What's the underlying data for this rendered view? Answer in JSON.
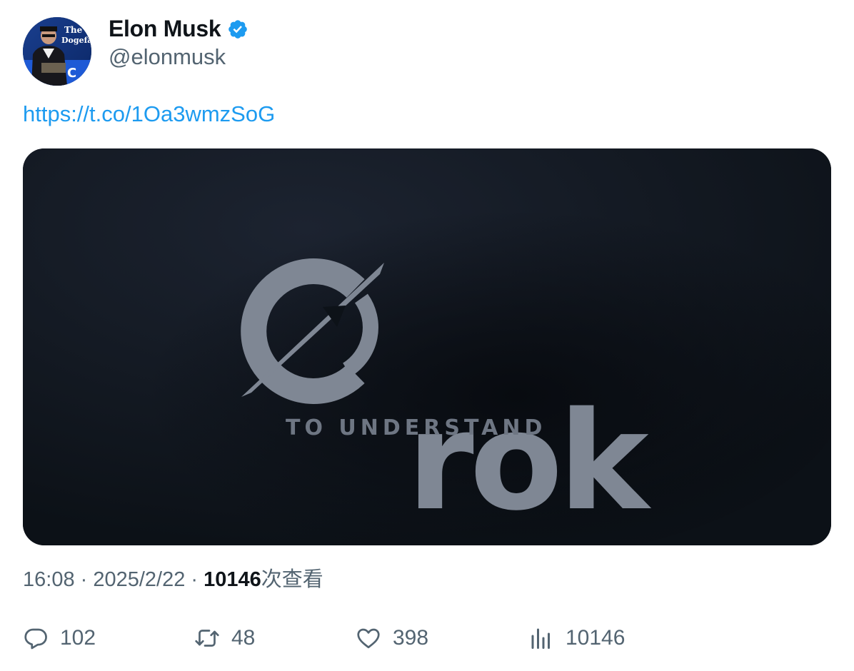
{
  "author": {
    "display_name": "Elon Musk",
    "handle": "@elonmusk",
    "verified": true,
    "avatar_text": "The Dogefa"
  },
  "tweet": {
    "link_text": "https://t.co/1Oa3wmzSoG"
  },
  "media": {
    "logo_text": "rok",
    "tagline": "TO UNDERSTAND"
  },
  "meta": {
    "time_date": "16:08 · 2025/2/22 · ",
    "views_count": "10146",
    "views_label": "次查看"
  },
  "actions": {
    "replies": "102",
    "retweets": "48",
    "likes": "398",
    "views": "10146"
  },
  "colors": {
    "link": "#1d9bf0",
    "secondary_text": "#536471",
    "verified_badge": "#1d9bf0",
    "media_bg": "#0d1218"
  }
}
